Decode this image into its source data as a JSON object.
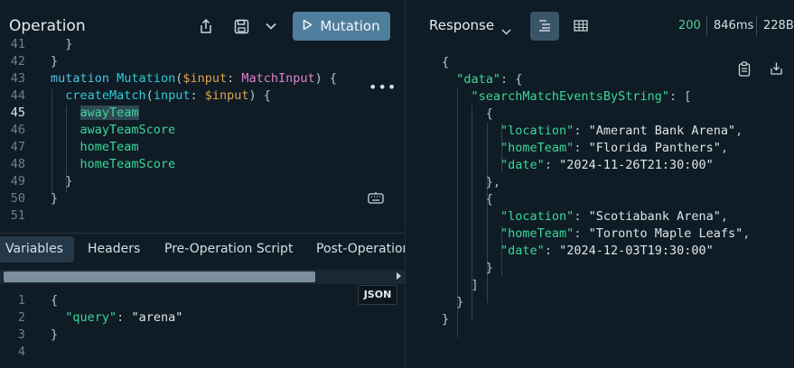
{
  "operation": {
    "title": "Operation",
    "run_label": "Mutation",
    "icons": [
      "share-icon",
      "save-icon",
      "chevron-down-icon",
      "play-icon"
    ]
  },
  "editor": {
    "lines": [
      {
        "n": "41",
        "tokens": [
          {
            "t": "  }",
            "c": "punc"
          }
        ]
      },
      {
        "n": "42",
        "tokens": [
          {
            "t": "}",
            "c": "punc"
          }
        ]
      },
      {
        "n": "43",
        "tokens": [
          {
            "t": "mutation",
            "c": "kw"
          },
          {
            "t": " ",
            "c": "punc"
          },
          {
            "t": "Mutation",
            "c": "fn"
          },
          {
            "t": "(",
            "c": "punc"
          },
          {
            "t": "$input",
            "c": "var"
          },
          {
            "t": ": ",
            "c": "punc"
          },
          {
            "t": "MatchInput",
            "c": "type"
          },
          {
            "t": ") {",
            "c": "punc"
          }
        ]
      },
      {
        "n": "44",
        "tokens": [
          {
            "t": "  ",
            "c": "punc"
          },
          {
            "t": "createMatch",
            "c": "fn"
          },
          {
            "t": "(",
            "c": "punc"
          },
          {
            "t": "input",
            "c": "fn"
          },
          {
            "t": ": ",
            "c": "punc"
          },
          {
            "t": "$input",
            "c": "var"
          },
          {
            "t": ") ",
            "c": "punc"
          },
          {
            "t": "{",
            "c": "punc"
          }
        ]
      },
      {
        "n": "45",
        "tokens": [
          {
            "t": "    ",
            "c": "punc"
          },
          {
            "t": "awayTeam",
            "c": "field"
          }
        ]
      },
      {
        "n": "46",
        "tokens": [
          {
            "t": "    ",
            "c": "punc"
          },
          {
            "t": "awayTeamScore",
            "c": "field"
          }
        ]
      },
      {
        "n": "47",
        "tokens": [
          {
            "t": "    ",
            "c": "punc"
          },
          {
            "t": "homeTeam",
            "c": "field"
          }
        ]
      },
      {
        "n": "48",
        "tokens": [
          {
            "t": "    ",
            "c": "punc"
          },
          {
            "t": "homeTeamScore",
            "c": "field"
          }
        ]
      },
      {
        "n": "49",
        "tokens": [
          {
            "t": "  ",
            "c": "punc"
          },
          {
            "t": "}",
            "c": "punc"
          }
        ]
      },
      {
        "n": "50",
        "tokens": [
          {
            "t": "}",
            "c": "punc"
          }
        ]
      },
      {
        "n": "51",
        "tokens": []
      }
    ],
    "active_line": "45",
    "more_label": "•••"
  },
  "tabs": {
    "variables": "Variables",
    "headers": "Headers",
    "pre_script": "Pre-Operation Script",
    "post_script": "Post-Operation"
  },
  "json_badge": "JSON",
  "variables": {
    "lines": [
      {
        "n": "1",
        "tokens": [
          {
            "t": "{",
            "c": "punc"
          }
        ]
      },
      {
        "n": "2",
        "tokens": [
          {
            "t": "  ",
            "c": "punc"
          },
          {
            "t": "\"query\"",
            "c": "key"
          },
          {
            "t": ": ",
            "c": "punc"
          },
          {
            "t": "\"arena\"",
            "c": "str"
          }
        ]
      },
      {
        "n": "3",
        "tokens": [
          {
            "t": "}",
            "c": "punc"
          }
        ]
      },
      {
        "n": "4",
        "tokens": []
      }
    ]
  },
  "response": {
    "title": "Response",
    "status": "200",
    "time": "846ms",
    "size": "228B",
    "lines": [
      {
        "tokens": [
          {
            "t": "{",
            "c": "punc"
          }
        ]
      },
      {
        "tokens": [
          {
            "t": "  ",
            "c": "punc"
          },
          {
            "t": "\"data\"",
            "c": "key"
          },
          {
            "t": ": {",
            "c": "punc"
          }
        ]
      },
      {
        "tokens": [
          {
            "t": "    ",
            "c": "punc"
          },
          {
            "t": "\"searchMatchEventsByString\"",
            "c": "key"
          },
          {
            "t": ": [",
            "c": "punc"
          }
        ]
      },
      {
        "tokens": [
          {
            "t": "      {",
            "c": "punc"
          }
        ]
      },
      {
        "tokens": [
          {
            "t": "        ",
            "c": "punc"
          },
          {
            "t": "\"location\"",
            "c": "key"
          },
          {
            "t": ": ",
            "c": "punc"
          },
          {
            "t": "\"Amerant Bank Arena\"",
            "c": "str"
          },
          {
            "t": ",",
            "c": "punc"
          }
        ]
      },
      {
        "tokens": [
          {
            "t": "        ",
            "c": "punc"
          },
          {
            "t": "\"homeTeam\"",
            "c": "key"
          },
          {
            "t": ": ",
            "c": "punc"
          },
          {
            "t": "\"Florida Panthers\"",
            "c": "str"
          },
          {
            "t": ",",
            "c": "punc"
          }
        ]
      },
      {
        "tokens": [
          {
            "t": "        ",
            "c": "punc"
          },
          {
            "t": "\"date\"",
            "c": "key"
          },
          {
            "t": ": ",
            "c": "punc"
          },
          {
            "t": "\"2024-11-26T21:30:00\"",
            "c": "str"
          }
        ]
      },
      {
        "tokens": [
          {
            "t": "      },",
            "c": "punc"
          }
        ]
      },
      {
        "tokens": [
          {
            "t": "      {",
            "c": "punc"
          }
        ]
      },
      {
        "tokens": [
          {
            "t": "        ",
            "c": "punc"
          },
          {
            "t": "\"location\"",
            "c": "key"
          },
          {
            "t": ": ",
            "c": "punc"
          },
          {
            "t": "\"Scotiabank Arena\"",
            "c": "str"
          },
          {
            "t": ",",
            "c": "punc"
          }
        ]
      },
      {
        "tokens": [
          {
            "t": "        ",
            "c": "punc"
          },
          {
            "t": "\"homeTeam\"",
            "c": "key"
          },
          {
            "t": ": ",
            "c": "punc"
          },
          {
            "t": "\"Toronto Maple Leafs\"",
            "c": "str"
          },
          {
            "t": ",",
            "c": "punc"
          }
        ]
      },
      {
        "tokens": [
          {
            "t": "        ",
            "c": "punc"
          },
          {
            "t": "\"date\"",
            "c": "key"
          },
          {
            "t": ": ",
            "c": "punc"
          },
          {
            "t": "\"2024-12-03T19:30:00\"",
            "c": "str"
          }
        ]
      },
      {
        "tokens": [
          {
            "t": "      }",
            "c": "punc"
          }
        ]
      },
      {
        "tokens": [
          {
            "t": "    ]",
            "c": "punc"
          }
        ]
      },
      {
        "tokens": [
          {
            "t": "  }",
            "c": "punc"
          }
        ]
      },
      {
        "tokens": [
          {
            "t": "}",
            "c": "punc"
          }
        ]
      }
    ]
  },
  "colors": {
    "background": "#0f1c25",
    "accent_button": "#4f7d9c",
    "status_ok": "#52d093",
    "json_key": "#3bd79a",
    "keyword": "#4ec1e6",
    "variable": "#e0a14f",
    "type": "#e07fd0"
  }
}
